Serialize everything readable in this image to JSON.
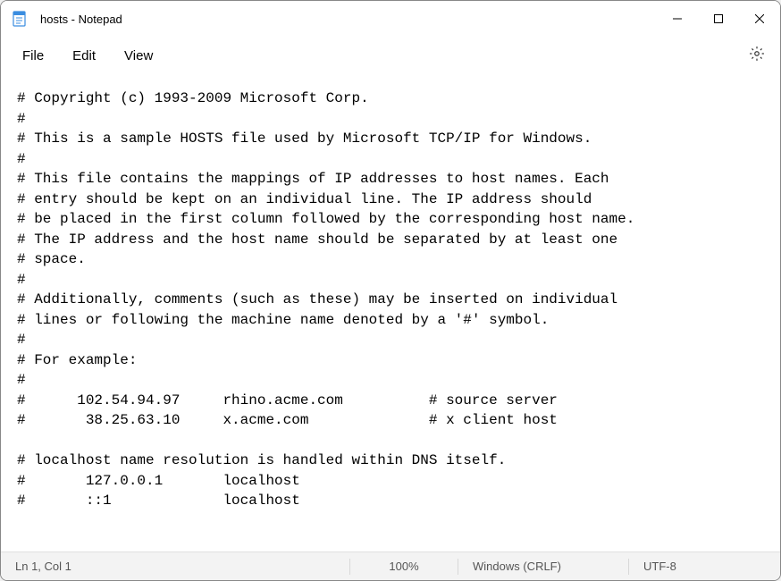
{
  "window": {
    "title": "hosts - Notepad"
  },
  "menu": {
    "file": "File",
    "edit": "Edit",
    "view": "View"
  },
  "editor": {
    "content": "# Copyright (c) 1993-2009 Microsoft Corp.\n#\n# This is a sample HOSTS file used by Microsoft TCP/IP for Windows.\n#\n# This file contains the mappings of IP addresses to host names. Each\n# entry should be kept on an individual line. The IP address should\n# be placed in the first column followed by the corresponding host name.\n# The IP address and the host name should be separated by at least one\n# space.\n#\n# Additionally, comments (such as these) may be inserted on individual\n# lines or following the machine name denoted by a '#' symbol.\n#\n# For example:\n#\n#      102.54.94.97     rhino.acme.com          # source server\n#       38.25.63.10     x.acme.com              # x client host\n\n# localhost name resolution is handled within DNS itself.\n#\t127.0.0.1       localhost\n#\t::1             localhost"
  },
  "status": {
    "position": "Ln 1, Col 1",
    "zoom": "100%",
    "line_ending": "Windows (CRLF)",
    "encoding": "UTF-8"
  }
}
